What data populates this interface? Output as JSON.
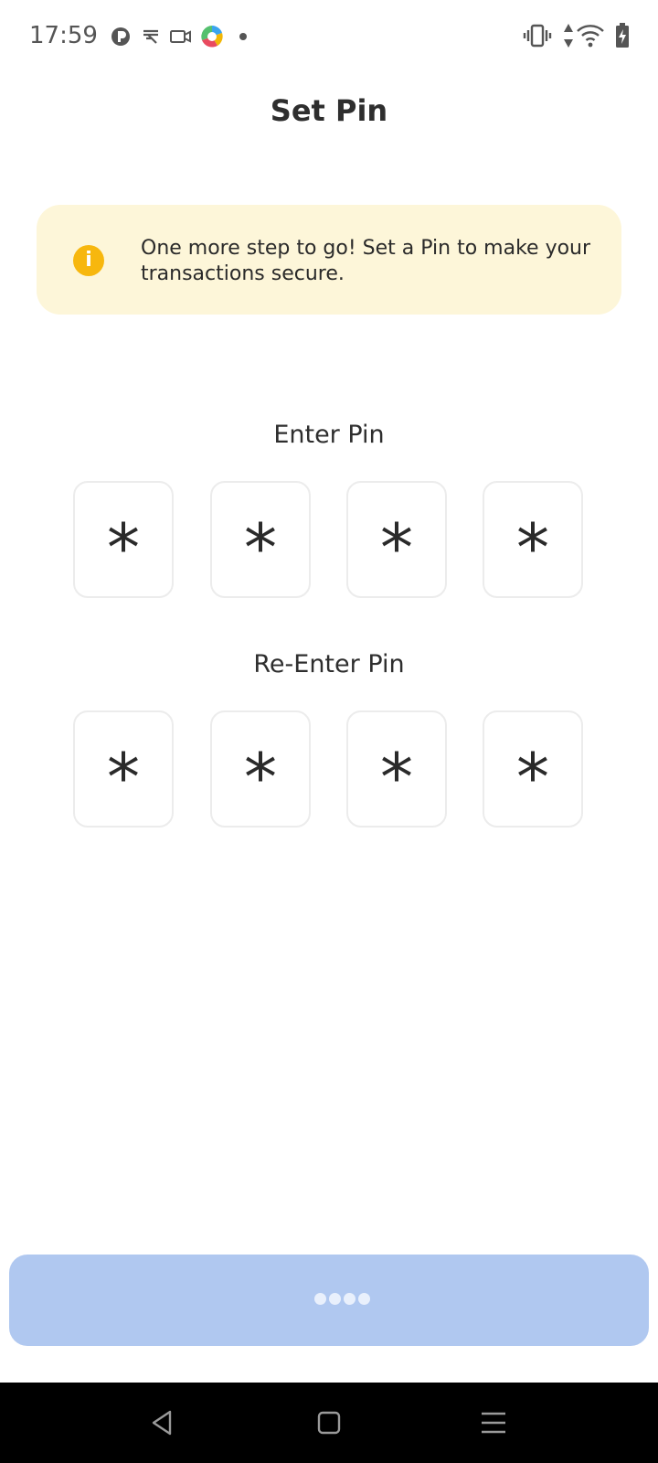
{
  "status_bar": {
    "time": "17:59",
    "left_icons": [
      "pocket-icon",
      "rupee-app-icon",
      "video-icon",
      "colorful-app-icon",
      "dot-icon"
    ],
    "right_icons": [
      "vibrate-icon",
      "data-arrows-icon",
      "wifi-icon",
      "battery-charging-icon"
    ]
  },
  "header": {
    "title": "Set Pin"
  },
  "info_banner": {
    "icon": "info-icon",
    "icon_glyph": "i",
    "message": "One more step to go! Set a Pin to make your transactions secure.",
    "background": "#fdf6d9",
    "icon_color": "#f7b70e"
  },
  "enter_pin": {
    "label": "Enter Pin",
    "digits": [
      "*",
      "*",
      "*",
      "*"
    ]
  },
  "reenter_pin": {
    "label": "Re-Enter Pin",
    "digits": [
      "*",
      "*",
      "*",
      "*"
    ]
  },
  "submit": {
    "state": "loading",
    "color": "#b0c8f0"
  },
  "nav_bar": {
    "buttons": [
      "back-icon",
      "home-icon",
      "menu-icon"
    ]
  }
}
